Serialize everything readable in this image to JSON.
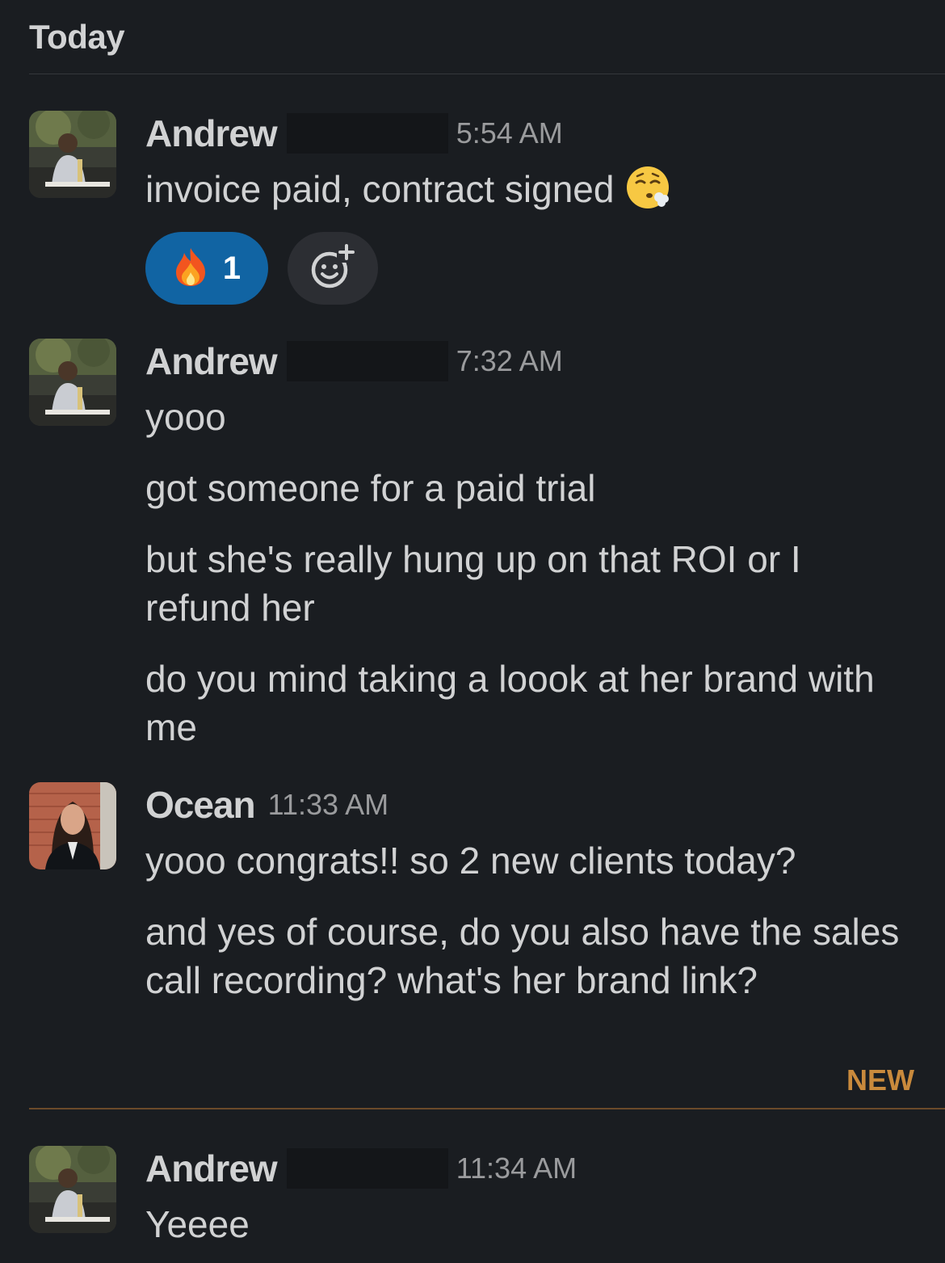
{
  "day_label": "Today",
  "new_label": "NEW",
  "colors": {
    "background": "#1a1d21",
    "reaction_pill": "#1164a3",
    "new_marker": "#c98a3c",
    "timestamp": "#9a9b9d"
  },
  "messages": [
    {
      "sender": "Andrew",
      "time": "5:54 AM",
      "avatar": "andrew-avatar",
      "paragraphs": [
        "invoice paid, contract signed"
      ],
      "inline_emoji": "face-exhaling-icon",
      "reactions": [
        {
          "emoji": "fire-icon",
          "count": "1"
        }
      ],
      "add_reaction_icon": "add-reaction-icon"
    },
    {
      "sender": "Andrew",
      "time": "7:32 AM",
      "avatar": "andrew-avatar",
      "paragraphs": [
        "yooo",
        "got someone for a paid trial",
        "but she's really hung up on that ROI or I refund her",
        "do you mind taking a loook at her brand with me"
      ]
    },
    {
      "sender": "Ocean",
      "time": "11:33 AM",
      "avatar": "ocean-avatar",
      "paragraphs": [
        "yooo congrats!! so 2 new clients today?",
        "and yes of course, do you also have the sales call recording? what's her brand link?"
      ]
    },
    {
      "sender": "Andrew",
      "time": "11:34 AM",
      "avatar": "andrew-avatar",
      "paragraphs": [
        "Yeeee"
      ]
    }
  ]
}
